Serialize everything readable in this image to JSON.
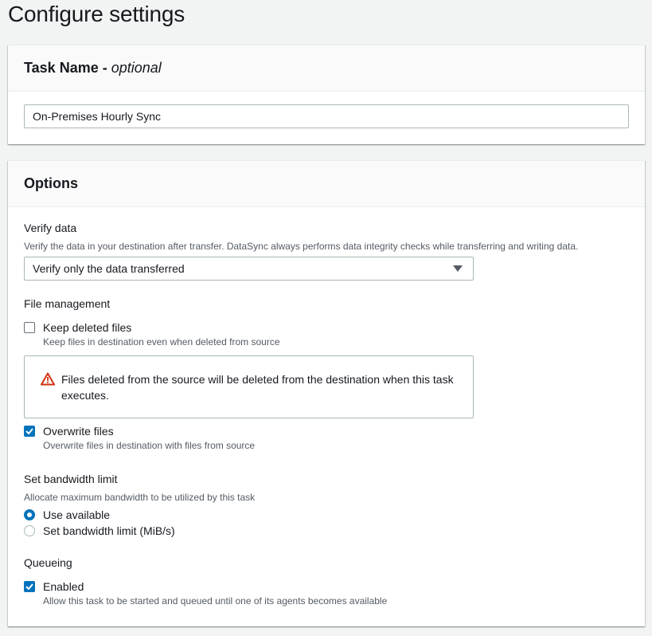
{
  "page": {
    "title": "Configure settings"
  },
  "task_name": {
    "header": "Task Name -",
    "header_optional": "optional",
    "value": "On-Premises Hourly Sync"
  },
  "options": {
    "header": "Options",
    "verify_data": {
      "label": "Verify data",
      "description": "Verify the data in your destination after transfer. DataSync always performs data integrity checks while transferring and writing data.",
      "selected": "Verify only the data transferred"
    },
    "file_management": {
      "label": "File management",
      "keep_deleted": {
        "label": "Keep deleted files",
        "description": "Keep files in destination even when deleted from source",
        "checked": false
      },
      "warning": "Files deleted from the source will be deleted from the destination when this task executes.",
      "overwrite": {
        "label": "Overwrite files",
        "description": "Overwrite files in destination with files from source",
        "checked": true
      }
    },
    "bandwidth": {
      "label": "Set bandwidth limit",
      "description": "Allocate maximum bandwidth to be utilized by this task",
      "use_available": "Use available",
      "set_limit": "Set bandwidth limit (MiB/s)",
      "selected": "Use available"
    },
    "queueing": {
      "label": "Queueing",
      "enabled": {
        "label": "Enabled",
        "description": "Allow this task to be started and queued until one of its agents becomes available",
        "checked": true
      }
    }
  },
  "colors": {
    "accent": "#0073bb",
    "warning": "#d13212",
    "background": "#f2f3f3",
    "text": "#16191f",
    "secondary_text": "#545b64"
  }
}
